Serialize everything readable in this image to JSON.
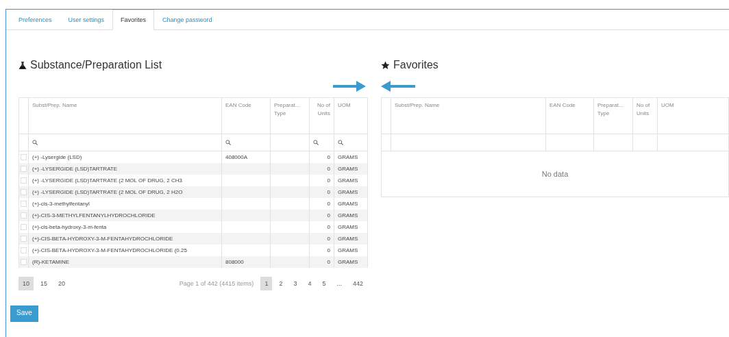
{
  "tabs": [
    {
      "label": "Preferences",
      "selected": false
    },
    {
      "label": "User settings",
      "selected": false
    },
    {
      "label": "Favorites",
      "selected": true
    },
    {
      "label": "Change password",
      "selected": false
    }
  ],
  "list_panel": {
    "title": "Substance/Preparation List",
    "columns": [
      {
        "label": "Subst/Prep. Name",
        "filter": true
      },
      {
        "label": "EAN Code",
        "filter": true
      },
      {
        "label": "Preparat... Type",
        "filter": false
      },
      {
        "label": "No of Units",
        "filter": true
      },
      {
        "label": "UOM",
        "filter": true
      }
    ],
    "rows": [
      {
        "checked": false,
        "cells": [
          "(+) -Lysergide (LSD)",
          "408000A",
          "",
          "0",
          "GRAMS"
        ]
      },
      {
        "checked": false,
        "cells": [
          "(+) -LYSERGIDE (LSD)TARTRATE",
          "",
          "",
          "0",
          "GRAMS"
        ]
      },
      {
        "checked": false,
        "cells": [
          "(+) -LYSERGIDE (LSD)TARTRATE (2 MOL OF DRUG, 2 CH3",
          "",
          "",
          "0",
          "GRAMS"
        ]
      },
      {
        "checked": false,
        "cells": [
          "(+) -LYSERGIDE (LSD)TARTRATE (2 MOL OF DRUG, 2 H2O",
          "",
          "",
          "0",
          "GRAMS"
        ]
      },
      {
        "checked": false,
        "cells": [
          "(+)-cis-3-methylfentanyl",
          "",
          "",
          "0",
          "GRAMS"
        ]
      },
      {
        "checked": false,
        "cells": [
          "(+)-CIS-3-METHYLFENTANYLHYDROCHLORIDE",
          "",
          "",
          "0",
          "GRAMS"
        ]
      },
      {
        "checked": false,
        "cells": [
          "(+)-cis-beta-hydroxy-3-m-fenta",
          "",
          "",
          "0",
          "GRAMS"
        ]
      },
      {
        "checked": false,
        "cells": [
          "(+)-CIS-BETA-HYDROXY-3-M-FENTAHYDROCHLORIDE",
          "",
          "",
          "0",
          "GRAMS"
        ]
      },
      {
        "checked": false,
        "cells": [
          "(+)-CIS-BETA-HYDROXY-3-M-FENTAHYDROCHLORIDE (0.25",
          "",
          "",
          "0",
          "GRAMS"
        ]
      },
      {
        "checked": false,
        "cells": [
          "(R)-KETAMINE",
          "808000",
          "",
          "0",
          "GRAMS"
        ]
      }
    ],
    "page_sizes": [
      {
        "label": "10",
        "selected": true
      },
      {
        "label": "15",
        "selected": false
      },
      {
        "label": "20",
        "selected": false
      }
    ],
    "page_info": "Page 1 of 442 (4415 items)",
    "pages": [
      {
        "label": "1",
        "selected": true
      },
      {
        "label": "2",
        "selected": false
      },
      {
        "label": "3",
        "selected": false
      },
      {
        "label": "4",
        "selected": false
      },
      {
        "label": "5",
        "selected": false
      },
      {
        "label": "...",
        "selected": false
      },
      {
        "label": "442",
        "selected": false
      }
    ]
  },
  "favorites_panel": {
    "title": "Favorites",
    "columns": [
      {
        "label": "Subst/Prep. Name",
        "filter": false
      },
      {
        "label": "EAN Code",
        "filter": false
      },
      {
        "label": "Preparat... Type",
        "filter": false
      },
      {
        "label": "No of Units",
        "filter": false
      },
      {
        "label": "UOM",
        "filter": false
      }
    ],
    "empty_text": "No data"
  },
  "save_button": "Save"
}
